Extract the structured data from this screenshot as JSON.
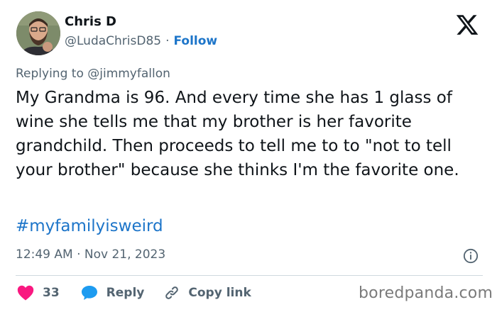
{
  "author": {
    "name": "Chris D",
    "handle": "@LudaChrisD85",
    "separator": "·",
    "follow_label": "Follow"
  },
  "platform_icon": "x-logo-icon",
  "replying_to": "Replying to @jimmyfallon",
  "tweet": {
    "text": "My Grandma is 96. And every time she has 1 glass of wine she tells me that my brother is her favorite grandchild. Then proceeds to tell me to to \"not to tell your brother\" because she thinks I'm the favorite one.",
    "hashtag": "#myfamilyisweird"
  },
  "timestamp": "12:49 AM · Nov 21, 2023",
  "actions": {
    "like_count": "33",
    "reply_label": "Reply",
    "copy_link_label": "Copy link"
  },
  "watermark": "boredpanda.com",
  "colors": {
    "link": "#1d75c9",
    "like": "#f91880",
    "secondary_text": "#536471",
    "primary_text": "#0f1419"
  }
}
